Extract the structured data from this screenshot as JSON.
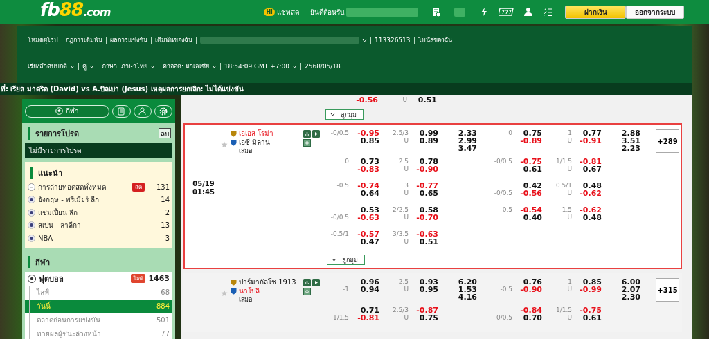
{
  "header": {
    "logo": [
      {
        "text": "fb",
        "kind": "brand"
      },
      {
        "text": "88",
        "kind": "accent"
      },
      {
        "text": ".com",
        "kind": "domain"
      }
    ],
    "chat": {
      "badge": "Hi",
      "label": "แชทสด"
    },
    "welcome": "ยินดีต้อนรับ,",
    "buttons": [
      {
        "label": "ฝากเงิน",
        "kind": "primary"
      },
      {
        "label": "ออกจากระบบ",
        "kind": "secondary"
      }
    ]
  },
  "nav": {
    "row_1": [
      {
        "kind": "link",
        "text": "โหมดยุโรป"
      },
      {
        "kind": "link",
        "text": "กฎการเดิมพัน"
      },
      {
        "kind": "link",
        "text": "ผลการแข่งขัน"
      },
      {
        "kind": "link",
        "text": "เดิมพันของฉัน"
      },
      {
        "kind": "redacted"
      },
      {
        "kind": "link",
        "text": "113326513"
      },
      {
        "kind": "link",
        "text": "โบนัสของฉัน"
      }
    ],
    "row_2": [
      {
        "text": "เรียงลำดับปกติ",
        "dropdown": true
      },
      {
        "text": "คู่",
        "dropdown": true
      },
      {
        "text": "ภาษา: ภาษาไทย",
        "dropdown": true
      },
      {
        "text": "ค่าออด: มาเลเซีย",
        "dropdown": true
      },
      {
        "text": "18:54:09 GMT +7:00",
        "dropdown": true
      },
      {
        "text": "2568/05/18",
        "dropdown": false
      }
    ]
  },
  "ticker": "ที่: เรียล มาดริด (David) vs A.บิลเบา (Jesus) เหตุผลการยกเลิก: ไม่ได้แข่งขัน",
  "sidebar": {
    "tools": [
      {
        "kind": "sports",
        "label": "กีฬา",
        "selected": true
      },
      {
        "kind": "betslip",
        "selected": false
      },
      {
        "kind": "account",
        "selected": false
      },
      {
        "kind": "settings",
        "selected": false
      }
    ],
    "favorites": {
      "title": "รายการโปรด",
      "clear": "ลบ",
      "empty": "ไม่มีรายการโปรด"
    },
    "recommended": {
      "title": "แนะนำ",
      "items": [
        {
          "kind": "all",
          "name": "การถ่ายทอดสดทั้งหมด",
          "badge": "สด",
          "count": "131"
        },
        {
          "kind": "league",
          "name": "อังกฤษ - พรีเมียร์ ลีก",
          "count": "14"
        },
        {
          "kind": "league",
          "name": "แชมเปี้ยน ลีก",
          "count": "2"
        },
        {
          "kind": "league",
          "name": "สเปน - ลาลีกา",
          "count": "13"
        },
        {
          "kind": "league",
          "name": "NBA",
          "count": "3"
        }
      ]
    },
    "sports": {
      "title": "กีฬา",
      "items": [
        {
          "name": "ฟุตบอล",
          "badge": "ไลฟ์",
          "count": "1463",
          "children": [
            {
              "name": "ไลฟ์",
              "count": "68",
              "selected": false
            },
            {
              "name": "วันนี้",
              "count": "884",
              "selected": true
            },
            {
              "name": "ตลาดก่อนการแข่งขัน",
              "count": "501",
              "selected": false
            },
            {
              "name": "ทายผลผู้ชนะล่วงหน้า",
              "count": "77",
              "selected": false
            }
          ]
        }
      ]
    }
  },
  "odds": {
    "tail": {
      "hdp_odds": {
        "v": "-0.56",
        "neg": true
      },
      "ou_under": "U",
      "ou_odds": {
        "v": "0.51",
        "neg": false
      },
      "corners": "ลูกมุม"
    },
    "matches": [
      {
        "highlighted": true,
        "date": "05/19",
        "time": "01:45",
        "starred": false,
        "home": {
          "name": "เอเอส โรม่า",
          "favored": true
        },
        "away": {
          "name": "เอซี มิลาน",
          "favored": false
        },
        "draw": "เสมอ",
        "more": "+289",
        "corners": "ลูกมุม",
        "lines": [
          {
            "hdp": {
              "home_line": "-0/0.5",
              "odds": [
                {
                  "v": "-0.95",
                  "neg": true
                },
                {
                  "v": "0.85",
                  "neg": false
                }
              ]
            },
            "ou": {
              "line": "2.5/3",
              "under": "U",
              "odds": [
                {
                  "v": "0.99",
                  "neg": false
                },
                {
                  "v": "0.89",
                  "neg": false
                }
              ]
            },
            "x12": [
              "2.33",
              "2.99",
              "3.47"
            ],
            "h1_hdp": {
              "home_line": "0",
              "odds": [
                {
                  "v": "0.75",
                  "neg": false
                },
                {
                  "v": "-0.89",
                  "neg": true
                }
              ]
            },
            "h1_ou": {
              "line": "1",
              "under": "U",
              "odds": [
                {
                  "v": "0.77",
                  "neg": false
                },
                {
                  "v": "-0.91",
                  "neg": true
                }
              ]
            },
            "h1_x12": [
              "2.88",
              "3.51",
              "2.23"
            ]
          },
          {
            "hdp": {
              "home_line": "0",
              "odds": [
                {
                  "v": "0.73",
                  "neg": false
                },
                {
                  "v": "-0.83",
                  "neg": true
                }
              ]
            },
            "ou": {
              "line": "2.5",
              "under": "U",
              "odds": [
                {
                  "v": "0.78",
                  "neg": false
                },
                {
                  "v": "-0.90",
                  "neg": true
                }
              ]
            },
            "h1_hdp": {
              "home_line": "-0/0.5",
              "odds": [
                {
                  "v": "-0.75",
                  "neg": true
                },
                {
                  "v": "0.61",
                  "neg": false
                }
              ]
            },
            "h1_ou": {
              "line": "1/1.5",
              "under": "U",
              "odds": [
                {
                  "v": "-0.81",
                  "neg": true
                },
                {
                  "v": "0.67",
                  "neg": false
                }
              ]
            }
          },
          {
            "hdp": {
              "home_line": "-0.5",
              "odds": [
                {
                  "v": "-0.74",
                  "neg": true
                },
                {
                  "v": "0.64",
                  "neg": false
                }
              ]
            },
            "ou": {
              "line": "3",
              "under": "U",
              "odds": [
                {
                  "v": "-0.77",
                  "neg": true
                },
                {
                  "v": "0.65",
                  "neg": false
                }
              ]
            },
            "h1_hdp": {
              "away_line": "-0/0.5",
              "odds": [
                {
                  "v": "0.42",
                  "neg": false
                },
                {
                  "v": "-0.56",
                  "neg": true
                }
              ]
            },
            "h1_ou": {
              "line": "0.5/1",
              "under": "U",
              "odds": [
                {
                  "v": "0.48",
                  "neg": false
                },
                {
                  "v": "-0.62",
                  "neg": true
                }
              ]
            }
          },
          {
            "hdp": {
              "away_line": "-0/0.5",
              "odds": [
                {
                  "v": "0.53",
                  "neg": false
                },
                {
                  "v": "-0.63",
                  "neg": true
                }
              ]
            },
            "ou": {
              "line": "2/2.5",
              "under": "U",
              "odds": [
                {
                  "v": "0.58",
                  "neg": false
                },
                {
                  "v": "-0.70",
                  "neg": true
                }
              ]
            },
            "h1_hdp": {
              "home_line": "-0.5",
              "odds": [
                {
                  "v": "-0.54",
                  "neg": true
                },
                {
                  "v": "0.40",
                  "neg": false
                }
              ]
            },
            "h1_ou": {
              "line": "1.5",
              "under": "U",
              "odds": [
                {
                  "v": "-0.62",
                  "neg": true
                },
                {
                  "v": "0.48",
                  "neg": false
                }
              ]
            }
          },
          {
            "hdp": {
              "home_line": "-0.5/1",
              "odds": [
                {
                  "v": "-0.57",
                  "neg": true
                },
                {
                  "v": "0.47",
                  "neg": false
                }
              ]
            },
            "ou": {
              "line": "3/3.5",
              "under": "U",
              "odds": [
                {
                  "v": "-0.63",
                  "neg": true
                },
                {
                  "v": "0.51",
                  "neg": false
                }
              ]
            }
          }
        ]
      },
      {
        "highlighted": false,
        "starred": false,
        "home": {
          "name": "ปาร์มากัลโช 1913",
          "favored": false
        },
        "away": {
          "name": "นาโปลิ",
          "favored": true
        },
        "draw": "เสมอ",
        "more": "+315",
        "lines": [
          {
            "hdp": {
              "away_line": "-1",
              "odds": [
                {
                  "v": "0.96",
                  "neg": false
                },
                {
                  "v": "0.94",
                  "neg": false
                }
              ]
            },
            "ou": {
              "line": "2.5",
              "under": "U",
              "odds": [
                {
                  "v": "0.93",
                  "neg": false
                },
                {
                  "v": "0.95",
                  "neg": false
                }
              ]
            },
            "x12": [
              "6.20",
              "1.53",
              "4.16"
            ],
            "h1_hdp": {
              "away_line": "-0.5",
              "odds": [
                {
                  "v": "0.76",
                  "neg": false
                },
                {
                  "v": "-0.90",
                  "neg": true
                }
              ]
            },
            "h1_ou": {
              "line": "1",
              "under": "U",
              "odds": [
                {
                  "v": "0.85",
                  "neg": false
                },
                {
                  "v": "-0.99",
                  "neg": true
                }
              ]
            },
            "h1_x12": [
              "6.00",
              "2.07",
              "2.30"
            ]
          },
          {
            "hdp": {
              "away_line": "-1/1.5",
              "odds": [
                {
                  "v": "0.71",
                  "neg": false
                },
                {
                  "v": "-0.81",
                  "neg": true
                }
              ]
            },
            "ou": {
              "line": "2.5/3",
              "under": "U",
              "odds": [
                {
                  "v": "-0.87",
                  "neg": true
                },
                {
                  "v": "0.75",
                  "neg": false
                }
              ]
            },
            "h1_hdp": {
              "away_line": "-0/0.5",
              "odds": [
                {
                  "v": "-0.84",
                  "neg": true
                },
                {
                  "v": "0.70",
                  "neg": false
                }
              ]
            },
            "h1_ou": {
              "line": "1/1.5",
              "under": "U",
              "odds": [
                {
                  "v": "-0.75",
                  "neg": true
                },
                {
                  "v": "0.61",
                  "neg": false
                }
              ]
            }
          }
        ]
      }
    ]
  }
}
